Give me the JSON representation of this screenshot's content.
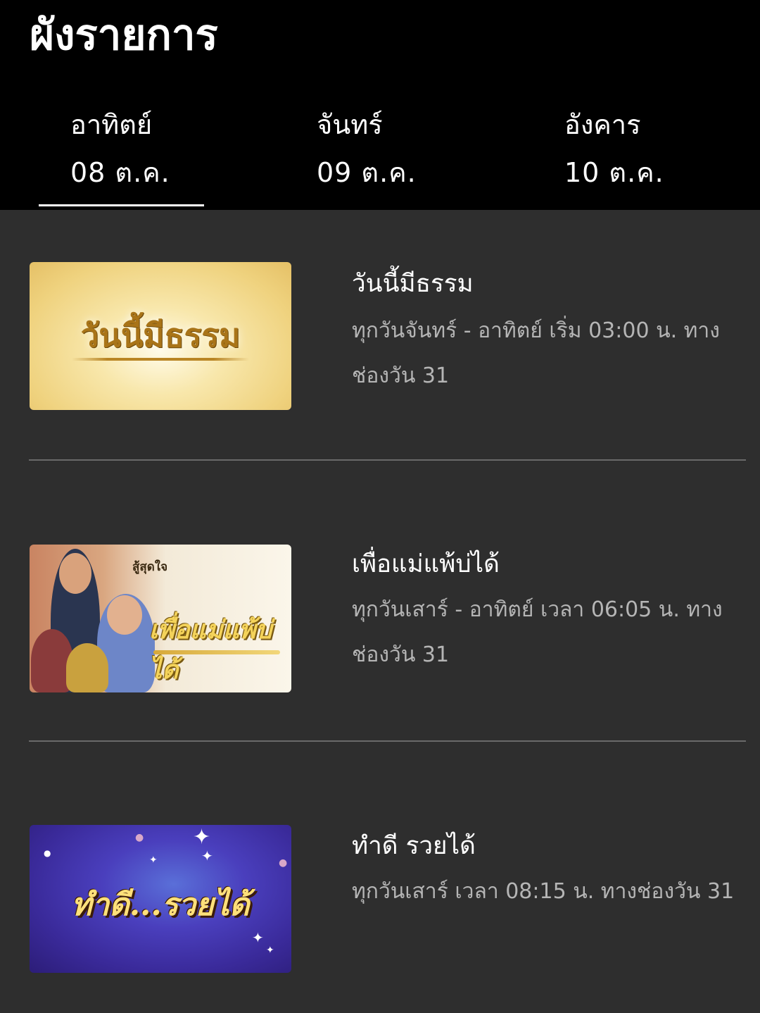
{
  "header": {
    "title": "ผังรายการ",
    "tabs": [
      {
        "day": "อาทิตย์",
        "date": "08 ต.ค.",
        "selected": true
      },
      {
        "day": "จันทร์",
        "date": "09 ต.ค.",
        "selected": false
      },
      {
        "day": "อังคาร",
        "date": "10 ต.ค.",
        "selected": false
      }
    ]
  },
  "programs": [
    {
      "title": "วันนี้มีธรรม",
      "schedule": "ทุกวันจันทร์ - อาทิตย์ เริ่ม 03:00 น. ทางช่องวัน 31",
      "thumb_logo": "วันนี้มีธรรม"
    },
    {
      "title": "เพื่อแม่แพ้บ่ได้",
      "schedule": "ทุกวันเสาร์ - อาทิตย์ เวลา 06:05 น. ทางช่องวัน 31",
      "thumb_tagline": "สู้สุดใจ",
      "thumb_logo": "เพื่อแม่แพ้บ่ได้"
    },
    {
      "title": "ทำดี รวยได้",
      "schedule": "ทุกวันเสาร์ เวลา 08:15 น. ทางช่องวัน 31",
      "thumb_logo": "ทำดี...รวยได้"
    }
  ],
  "colors": {
    "header_bg": "#000000",
    "body_bg": "#2e2e2e",
    "title_text": "#ffffff",
    "desc_text": "#b5b5b5",
    "divider": "#6a6a6a"
  }
}
